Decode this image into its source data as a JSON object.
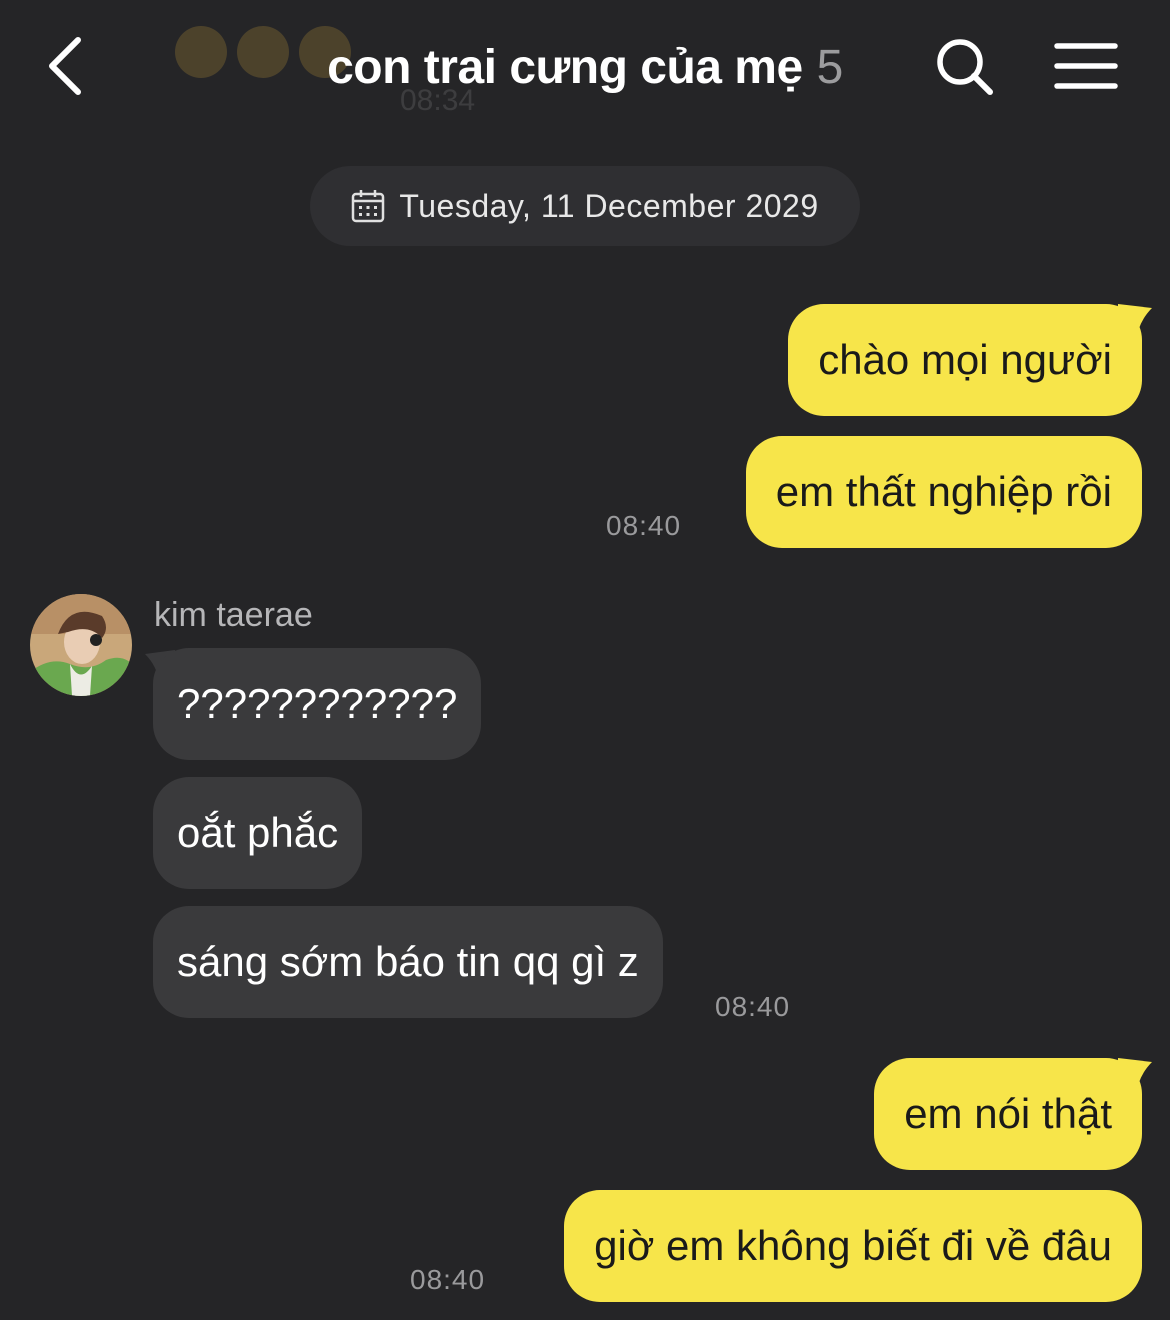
{
  "header": {
    "title": "con trai cưng của mẹ",
    "member_count": "5",
    "ghost_time": "08:34"
  },
  "date_chip": {
    "label": "Tuesday, 11 December 2029"
  },
  "messages": [
    {
      "direction": "out",
      "text": "chào mọi người"
    },
    {
      "direction": "out",
      "text": "em thất nghiệp rồi",
      "time": "08:40"
    },
    {
      "direction": "in",
      "sender": "kim taerae",
      "text": "????????????"
    },
    {
      "direction": "in",
      "text": "oắt phắc"
    },
    {
      "direction": "in",
      "text": "sáng sớm báo tin qq gì z",
      "time": "08:40"
    },
    {
      "direction": "out",
      "text": "em nói thật"
    },
    {
      "direction": "out",
      "text": "giờ em không biết đi về đâu",
      "time": "08:40"
    }
  ],
  "colors": {
    "background": "#252527",
    "outgoing_bubble": "#f7e54a",
    "incoming_bubble": "#3a3a3c",
    "timestamp": "#9a9a9c"
  },
  "icons": [
    "back-arrow-icon",
    "calendar-icon",
    "search-icon",
    "menu-icon"
  ]
}
